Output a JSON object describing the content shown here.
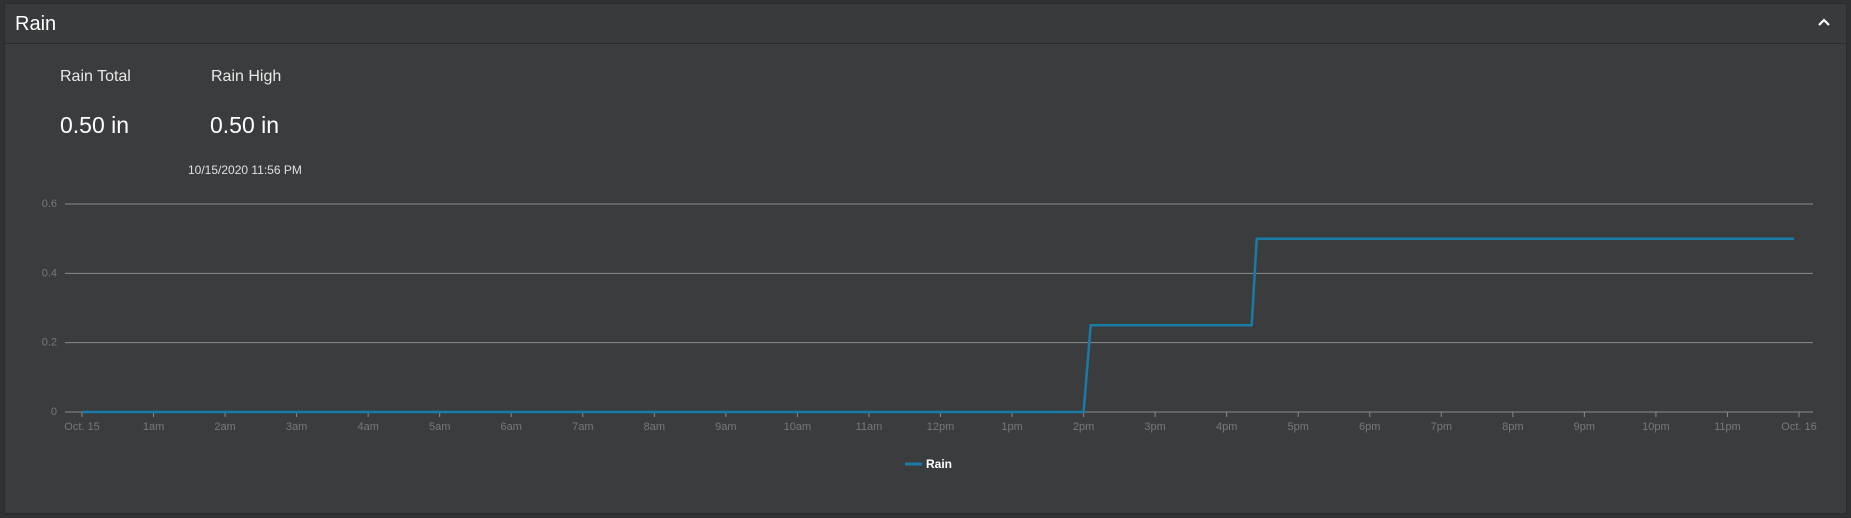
{
  "panel": {
    "title": "Rain",
    "collapse_icon": "chevron-up-icon"
  },
  "stats": {
    "total": {
      "label": "Rain Total",
      "value": "0.50 in"
    },
    "high": {
      "label": "Rain High",
      "value": "0.50 in",
      "timestamp": "10/15/2020 11:56 PM"
    }
  },
  "colors": {
    "series": "#1a7ba6",
    "grid": "#8a8b8d",
    "tick": "#77787a",
    "background": "#3b3c3e"
  },
  "chart_data": {
    "type": "line",
    "title": "",
    "xlabel": "",
    "ylabel": "",
    "ylim": [
      0,
      0.6
    ],
    "yticks": [
      "0",
      "0.2",
      "0.4",
      "0.6"
    ],
    "yticks_values": [
      0,
      0.2,
      0.4,
      0.6
    ],
    "xticks": [
      "Oct. 15",
      "1am",
      "2am",
      "3am",
      "4am",
      "5am",
      "6am",
      "7am",
      "8am",
      "9am",
      "10am",
      "11am",
      "12pm",
      "1pm",
      "2pm",
      "3pm",
      "4pm",
      "5pm",
      "6pm",
      "7pm",
      "8pm",
      "9pm",
      "10pm",
      "11pm",
      "Oct. 16"
    ],
    "xlim_hours": [
      0,
      24
    ],
    "grid": true,
    "legend": "bottom-center",
    "series": [
      {
        "name": "Rain",
        "x_hours": [
          0,
          14.0,
          14.1,
          16.35,
          16.42,
          23.93
        ],
        "values": [
          0,
          0,
          0.25,
          0.25,
          0.5,
          0.5
        ]
      }
    ]
  }
}
